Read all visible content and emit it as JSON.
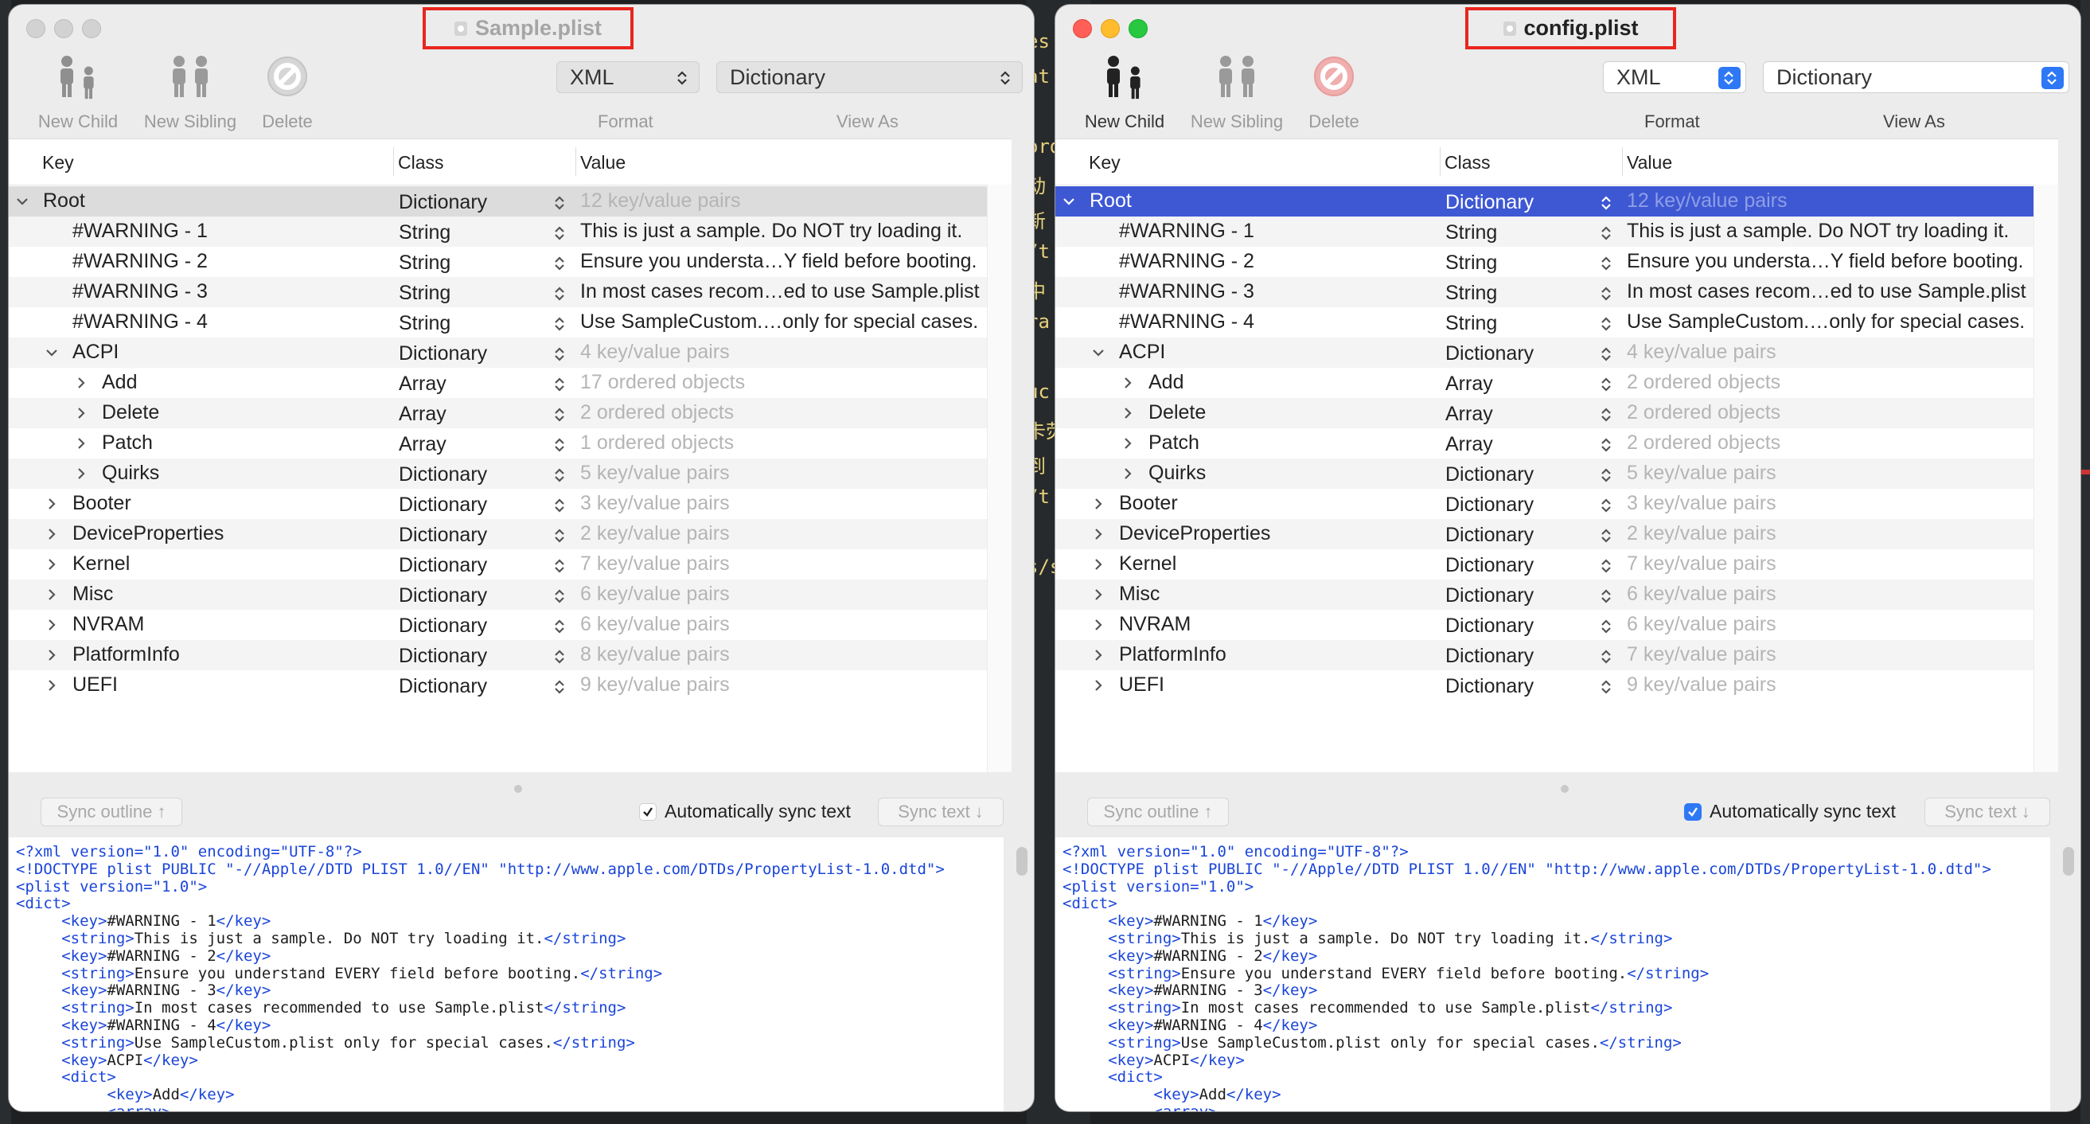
{
  "bg_editor_lines": [
    "es",
    "at",
    "",
    "ord",
    "动",
    "新",
    "/t",
    "中",
    "ra",
    "",
    "uc",
    "卡荧",
    "到",
    "/t",
    "",
    "s/s"
  ],
  "toolbar": {
    "new_child": "New Child",
    "new_sibling": "New Sibling",
    "delete": "Delete",
    "format_value": "XML",
    "view_as_value": "Dictionary",
    "format_label": "Format",
    "view_as_label": "View As"
  },
  "columns": {
    "key": "Key",
    "class": "Class",
    "value": "Value"
  },
  "bottom": {
    "sync_outline": "Sync outline ↑",
    "auto_sync": "Automatically sync text",
    "sync_text": "Sync text ↓"
  },
  "xml_lines": [
    [
      "<?xml version=\"1.0\" encoding=\"UTF-8\"?>",
      "",
      ""
    ],
    [
      "<!DOCTYPE plist PUBLIC \"-//Apple//DTD PLIST 1.0//EN\" \"http://www.apple.com/DTDs/PropertyList-1.0.dtd\">",
      "",
      ""
    ],
    [
      "<plist version=\"1.0\">",
      "",
      ""
    ],
    [
      "<dict>",
      "",
      ""
    ],
    [
      "     <key>",
      "#WARNING - 1",
      "</key>"
    ],
    [
      "     <string>",
      "This is just a sample. Do NOT try loading it.",
      "</string>"
    ],
    [
      "     <key>",
      "#WARNING - 2",
      "</key>"
    ],
    [
      "     <string>",
      "Ensure you understand EVERY field before booting.",
      "</string>"
    ],
    [
      "     <key>",
      "#WARNING - 3",
      "</key>"
    ],
    [
      "     <string>",
      "In most cases recommended to use Sample.plist",
      "</string>"
    ],
    [
      "     <key>",
      "#WARNING - 4",
      "</key>"
    ],
    [
      "     <string>",
      "Use SampleCustom.plist only for special cases.",
      "</string>"
    ],
    [
      "     <key>",
      "ACPI",
      "</key>"
    ],
    [
      "     <dict>",
      "",
      ""
    ],
    [
      "          <key>",
      "Add",
      "</key>"
    ],
    [
      "          <array>",
      "",
      ""
    ]
  ],
  "windows": [
    {
      "title": "Sample.plist",
      "active": false,
      "auto_sync_checked": true,
      "rows": [
        {
          "key": "Root",
          "class": "Dictionary",
          "value": "12 key/value pairs",
          "level": 0,
          "disc": "open",
          "dim": true,
          "sel": "gray"
        },
        {
          "key": "#WARNING - 1",
          "class": "String",
          "value": "This is just a sample. Do NOT try loading it.",
          "level": 1,
          "disc": "none",
          "dim": false
        },
        {
          "key": "#WARNING - 2",
          "class": "String",
          "value": "Ensure you understa…Y field before booting.",
          "level": 1,
          "disc": "none",
          "dim": false
        },
        {
          "key": "#WARNING - 3",
          "class": "String",
          "value": "In most cases recom…ed to use Sample.plist",
          "level": 1,
          "disc": "none",
          "dim": false
        },
        {
          "key": "#WARNING - 4",
          "class": "String",
          "value": "Use SampleCustom.…only for special cases.",
          "level": 1,
          "disc": "none",
          "dim": false
        },
        {
          "key": "ACPI",
          "class": "Dictionary",
          "value": "4 key/value pairs",
          "level": 1,
          "disc": "open",
          "dim": true
        },
        {
          "key": "Add",
          "class": "Array",
          "value": "17 ordered objects",
          "level": 2,
          "disc": "closed",
          "dim": true
        },
        {
          "key": "Delete",
          "class": "Array",
          "value": "2 ordered objects",
          "level": 2,
          "disc": "closed",
          "dim": true
        },
        {
          "key": "Patch",
          "class": "Array",
          "value": "1 ordered objects",
          "level": 2,
          "disc": "closed",
          "dim": true
        },
        {
          "key": "Quirks",
          "class": "Dictionary",
          "value": "5 key/value pairs",
          "level": 2,
          "disc": "closed",
          "dim": true
        },
        {
          "key": "Booter",
          "class": "Dictionary",
          "value": "3 key/value pairs",
          "level": 1,
          "disc": "closed",
          "dim": true
        },
        {
          "key": "DeviceProperties",
          "class": "Dictionary",
          "value": "2 key/value pairs",
          "level": 1,
          "disc": "closed",
          "dim": true
        },
        {
          "key": "Kernel",
          "class": "Dictionary",
          "value": "7 key/value pairs",
          "level": 1,
          "disc": "closed",
          "dim": true
        },
        {
          "key": "Misc",
          "class": "Dictionary",
          "value": "6 key/value pairs",
          "level": 1,
          "disc": "closed",
          "dim": true
        },
        {
          "key": "NVRAM",
          "class": "Dictionary",
          "value": "6 key/value pairs",
          "level": 1,
          "disc": "closed",
          "dim": true
        },
        {
          "key": "PlatformInfo",
          "class": "Dictionary",
          "value": "8 key/value pairs",
          "level": 1,
          "disc": "closed",
          "dim": true
        },
        {
          "key": "UEFI",
          "class": "Dictionary",
          "value": "9 key/value pairs",
          "level": 1,
          "disc": "closed",
          "dim": true
        }
      ]
    },
    {
      "title": "config.plist",
      "active": true,
      "auto_sync_checked": true,
      "rows": [
        {
          "key": "Root",
          "class": "Dictionary",
          "value": "12 key/value pairs",
          "level": 0,
          "disc": "open",
          "dim": true,
          "sel": "blue"
        },
        {
          "key": "#WARNING - 1",
          "class": "String",
          "value": "This is just a sample. Do NOT try loading it.",
          "level": 1,
          "disc": "none",
          "dim": false
        },
        {
          "key": "#WARNING - 2",
          "class": "String",
          "value": "Ensure you understa…Y field before booting.",
          "level": 1,
          "disc": "none",
          "dim": false
        },
        {
          "key": "#WARNING - 3",
          "class": "String",
          "value": "In most cases recom…ed to use Sample.plist",
          "level": 1,
          "disc": "none",
          "dim": false
        },
        {
          "key": "#WARNING - 4",
          "class": "String",
          "value": "Use SampleCustom.…only for special cases.",
          "level": 1,
          "disc": "none",
          "dim": false
        },
        {
          "key": "ACPI",
          "class": "Dictionary",
          "value": "4 key/value pairs",
          "level": 1,
          "disc": "open",
          "dim": true
        },
        {
          "key": "Add",
          "class": "Array",
          "value": "2 ordered objects",
          "level": 2,
          "disc": "closed",
          "dim": true
        },
        {
          "key": "Delete",
          "class": "Array",
          "value": "2 ordered objects",
          "level": 2,
          "disc": "closed",
          "dim": true
        },
        {
          "key": "Patch",
          "class": "Array",
          "value": "2 ordered objects",
          "level": 2,
          "disc": "closed",
          "dim": true
        },
        {
          "key": "Quirks",
          "class": "Dictionary",
          "value": "5 key/value pairs",
          "level": 2,
          "disc": "closed",
          "dim": true
        },
        {
          "key": "Booter",
          "class": "Dictionary",
          "value": "3 key/value pairs",
          "level": 1,
          "disc": "closed",
          "dim": true
        },
        {
          "key": "DeviceProperties",
          "class": "Dictionary",
          "value": "2 key/value pairs",
          "level": 1,
          "disc": "closed",
          "dim": true
        },
        {
          "key": "Kernel",
          "class": "Dictionary",
          "value": "7 key/value pairs",
          "level": 1,
          "disc": "closed",
          "dim": true
        },
        {
          "key": "Misc",
          "class": "Dictionary",
          "value": "6 key/value pairs",
          "level": 1,
          "disc": "closed",
          "dim": true
        },
        {
          "key": "NVRAM",
          "class": "Dictionary",
          "value": "6 key/value pairs",
          "level": 1,
          "disc": "closed",
          "dim": true
        },
        {
          "key": "PlatformInfo",
          "class": "Dictionary",
          "value": "7 key/value pairs",
          "level": 1,
          "disc": "closed",
          "dim": true
        },
        {
          "key": "UEFI",
          "class": "Dictionary",
          "value": "9 key/value pairs",
          "level": 1,
          "disc": "closed",
          "dim": true
        }
      ]
    }
  ],
  "colors": {
    "selection_blue": "#3e58d3",
    "highlight_red": "#e8261f",
    "accent_blue": "#2e78f6",
    "xml_tag_blue": "#1a45d9"
  }
}
